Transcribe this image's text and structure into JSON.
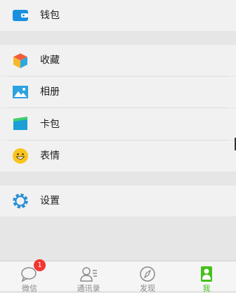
{
  "menu": {
    "wallet": "钱包",
    "favorites": "收藏",
    "album": "相册",
    "cards": "卡包",
    "stickers": "表情",
    "settings": "设置"
  },
  "tabbar": {
    "tabs": [
      {
        "label": "微信",
        "icon": "chat-bubble-icon",
        "badge": "1"
      },
      {
        "label": "通讯录",
        "icon": "contacts-icon"
      },
      {
        "label": "发现",
        "icon": "compass-icon"
      },
      {
        "label": "我",
        "icon": "me-profile-icon",
        "active": true
      }
    ]
  },
  "colors": {
    "accent_green": "#45c01a",
    "wallet_blue": "#1a8fe0",
    "badge_red": "#f43530",
    "background": "#e6e6e6",
    "row": "#f1f1f1"
  }
}
